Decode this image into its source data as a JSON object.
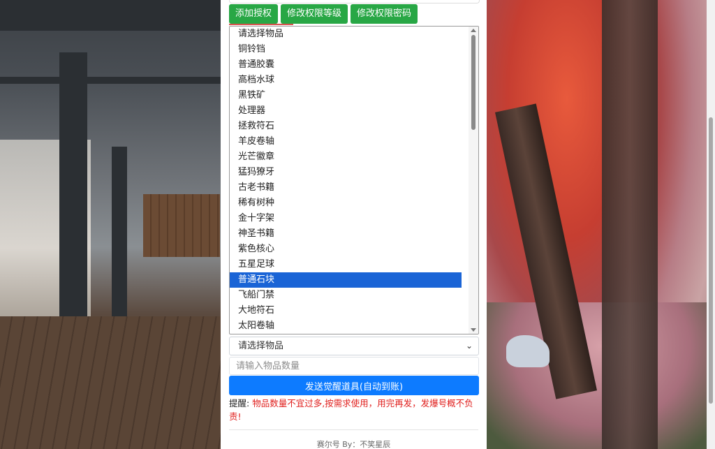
{
  "toolbar": {
    "add_auth": "添加授权",
    "modify_level": "修改权限等级",
    "modify_password": "修改权限密码"
  },
  "item_list": {
    "options": [
      "请选择物品",
      "铜铃铛",
      "普通胶囊",
      "高档水球",
      "黑铁矿",
      "处理器",
      "拯救符石",
      "羊皮卷轴",
      "光芒徽章",
      "猛犸獠牙",
      "古老书籍",
      "稀有树种",
      "金十字架",
      "神圣书籍",
      "紫色核心",
      "五星足球",
      "普通石块",
      "飞船门禁",
      "大地符石",
      "太阳卷轴"
    ],
    "selected": "普通石块"
  },
  "item_select": {
    "value": "请选择物品"
  },
  "quantity": {
    "placeholder": "请输入物品数量"
  },
  "send_button": "发送觉醒道具(自动到账)",
  "notice": {
    "label": "提醒:",
    "text": "物品数量不宜过多,按需求使用，用完再发，发爆号概不负责!"
  },
  "footer": "赛尔号 By：不笑星辰",
  "colors": {
    "green": "#28a745",
    "blue": "#0d7bff",
    "selected": "#1a64d6",
    "warning": "#e0201e"
  }
}
